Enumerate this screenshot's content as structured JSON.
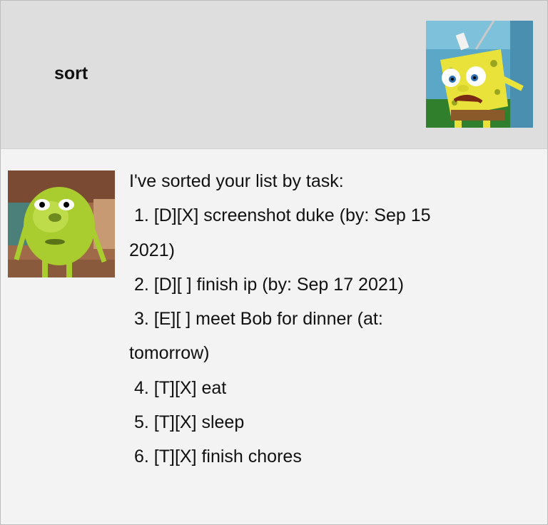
{
  "user_message": {
    "text": "sort",
    "avatar": "spongebob-avatar"
  },
  "bot_message": {
    "avatar": "mike-wazowski-avatar",
    "intro": "I've sorted your list by task:",
    "tasks": [
      {
        "line": " 1. [D][X] screenshot duke (by: Sep 15",
        "cont": "2021)"
      },
      {
        "line": " 2. [D][ ] finish ip (by: Sep 17 2021)",
        "cont": ""
      },
      {
        "line": " 3. [E][ ] meet Bob for dinner (at:",
        "cont": "tomorrow)"
      },
      {
        "line": " 4. [T][X] eat",
        "cont": ""
      },
      {
        "line": " 5. [T][X] sleep",
        "cont": ""
      },
      {
        "line": " 6. [T][X] finish chores",
        "cont": ""
      }
    ]
  },
  "colors": {
    "user_bg": "#dedede",
    "bot_bg": "#f3f3f3",
    "text": "#111111"
  }
}
